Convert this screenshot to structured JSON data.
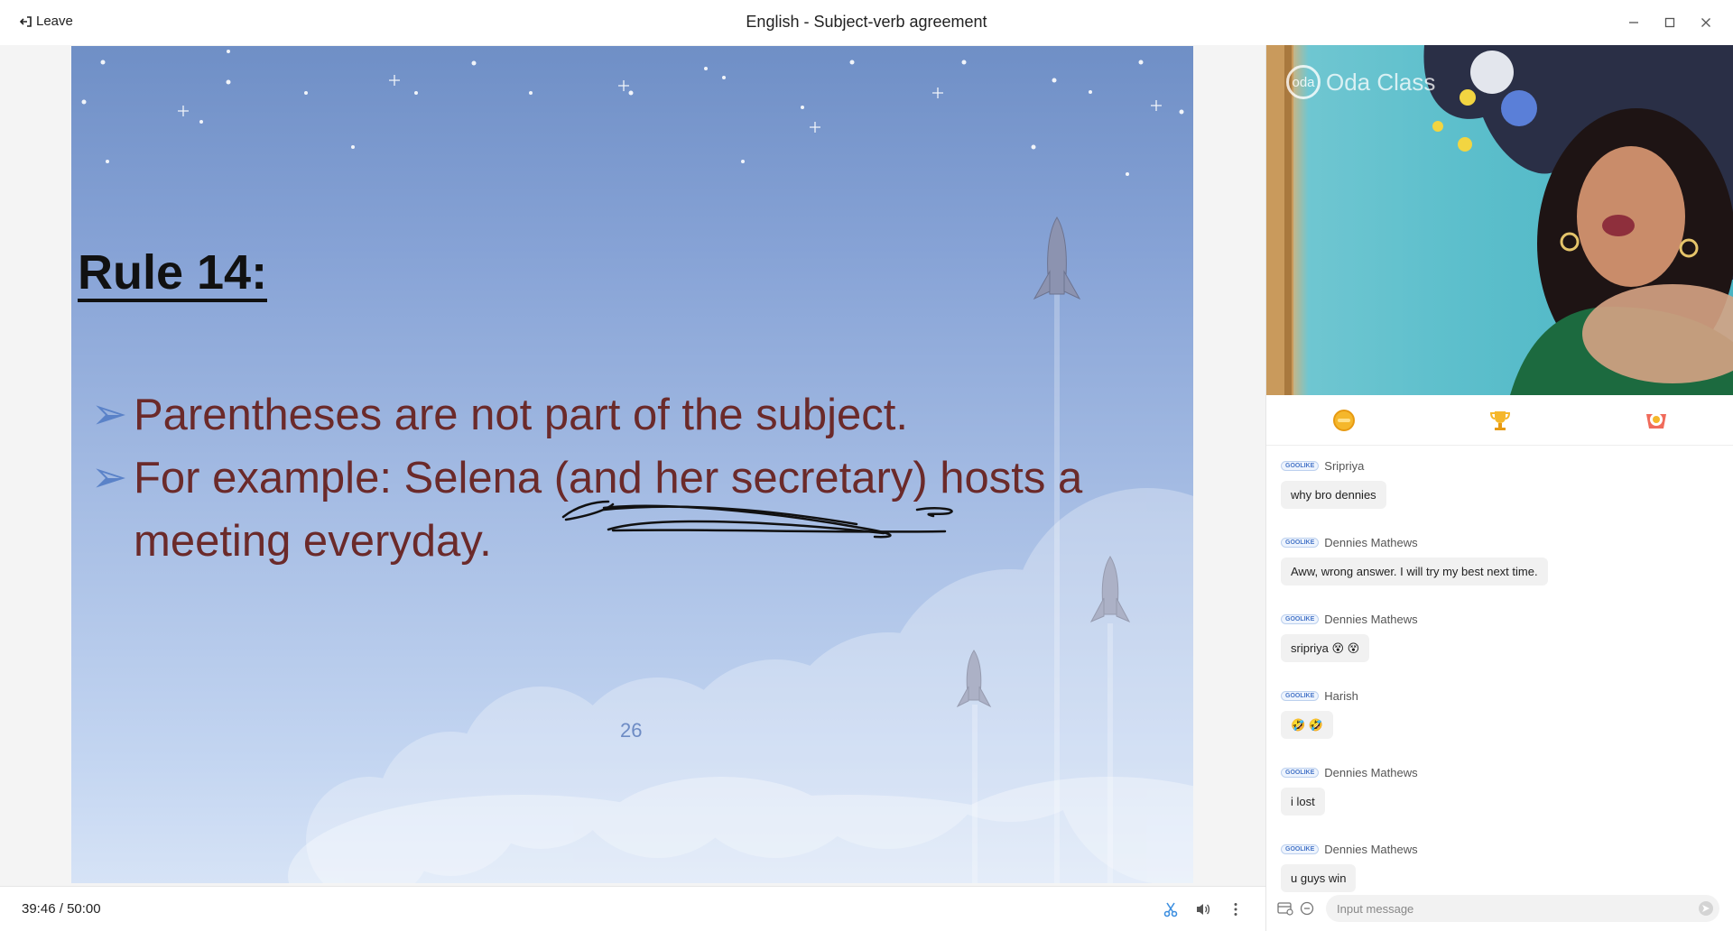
{
  "window": {
    "leave_label": "Leave",
    "title": "English - Subject-verb agreement"
  },
  "slide": {
    "heading": "Rule 14:",
    "bullets": [
      "Parentheses are not part of the subject.",
      "For example: Selena (and her secretary) hosts a meeting everyday."
    ],
    "page_number": "26"
  },
  "playback": {
    "current_time": "39:46",
    "separator": "/",
    "total_time": "50:00"
  },
  "video": {
    "watermark_logo": "oda",
    "watermark_text": "Oda Class"
  },
  "chat": {
    "badge_label": "GOOLIKE",
    "messages": [
      {
        "user": "Sripriya",
        "text": "why bro dennies"
      },
      {
        "user": "Dennies Mathews",
        "text": "Aww, wrong answer. I will try my best next time."
      },
      {
        "user": "Dennies Mathews",
        "text": "sripriya 😵 😵"
      },
      {
        "user": "Harish",
        "text": "🤣 🤣"
      },
      {
        "user": "Dennies Mathews",
        "text": "i lost"
      },
      {
        "user": "Dennies Mathews",
        "text": "u guys win"
      }
    ],
    "input_placeholder": "Input message"
  },
  "icons": {
    "reactions": [
      "oda-coin-icon",
      "trophy-icon",
      "award-badge-icon"
    ],
    "controls": [
      "scissors-icon",
      "volume-icon",
      "more-vertical-icon"
    ]
  }
}
